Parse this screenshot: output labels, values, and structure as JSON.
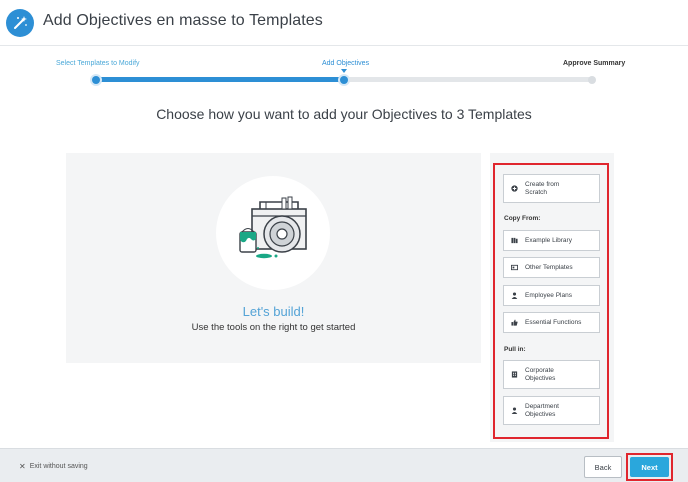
{
  "header": {
    "title": "Add Objectives en masse to Templates",
    "icon": "magic-wand-icon"
  },
  "stepper": {
    "steps": [
      {
        "label": "Select Templates to Modify",
        "state": "complete"
      },
      {
        "label": "Add Objectives",
        "state": "current"
      },
      {
        "label": "Approve Summary",
        "state": "upcoming"
      }
    ],
    "progress_fraction": 0.5,
    "colors": {
      "active": "#2d8fd5",
      "inactive": "#e3e6e9"
    }
  },
  "main": {
    "headline": "Choose how you want to add your Objectives to 3 Templates",
    "empty_state": {
      "title": "Let's build!",
      "subtitle": "Use the tools on the right to get started",
      "illustration": "toolbox-illustration"
    }
  },
  "tools": {
    "create_label": "Create from Scratch",
    "copy_from_heading": "Copy From:",
    "copy_from": [
      {
        "label": "Example Library",
        "icon": "library-icon"
      },
      {
        "label": "Other Templates",
        "icon": "template-icon"
      },
      {
        "label": "Employee Plans",
        "icon": "person-icon"
      },
      {
        "label": "Essential Functions",
        "icon": "thumbs-up-icon"
      }
    ],
    "pull_in_heading": "Pull in:",
    "pull_in": [
      {
        "label": "Corporate Objectives",
        "icon": "building-icon"
      },
      {
        "label": "Department Objectives",
        "icon": "person-icon"
      }
    ]
  },
  "footer": {
    "exit_label": "Exit without saving",
    "back_label": "Back",
    "next_label": "Next"
  },
  "colors": {
    "accent": "#2d8fd5",
    "highlight": "#e0262e",
    "next_button": "#2aa7dc"
  }
}
